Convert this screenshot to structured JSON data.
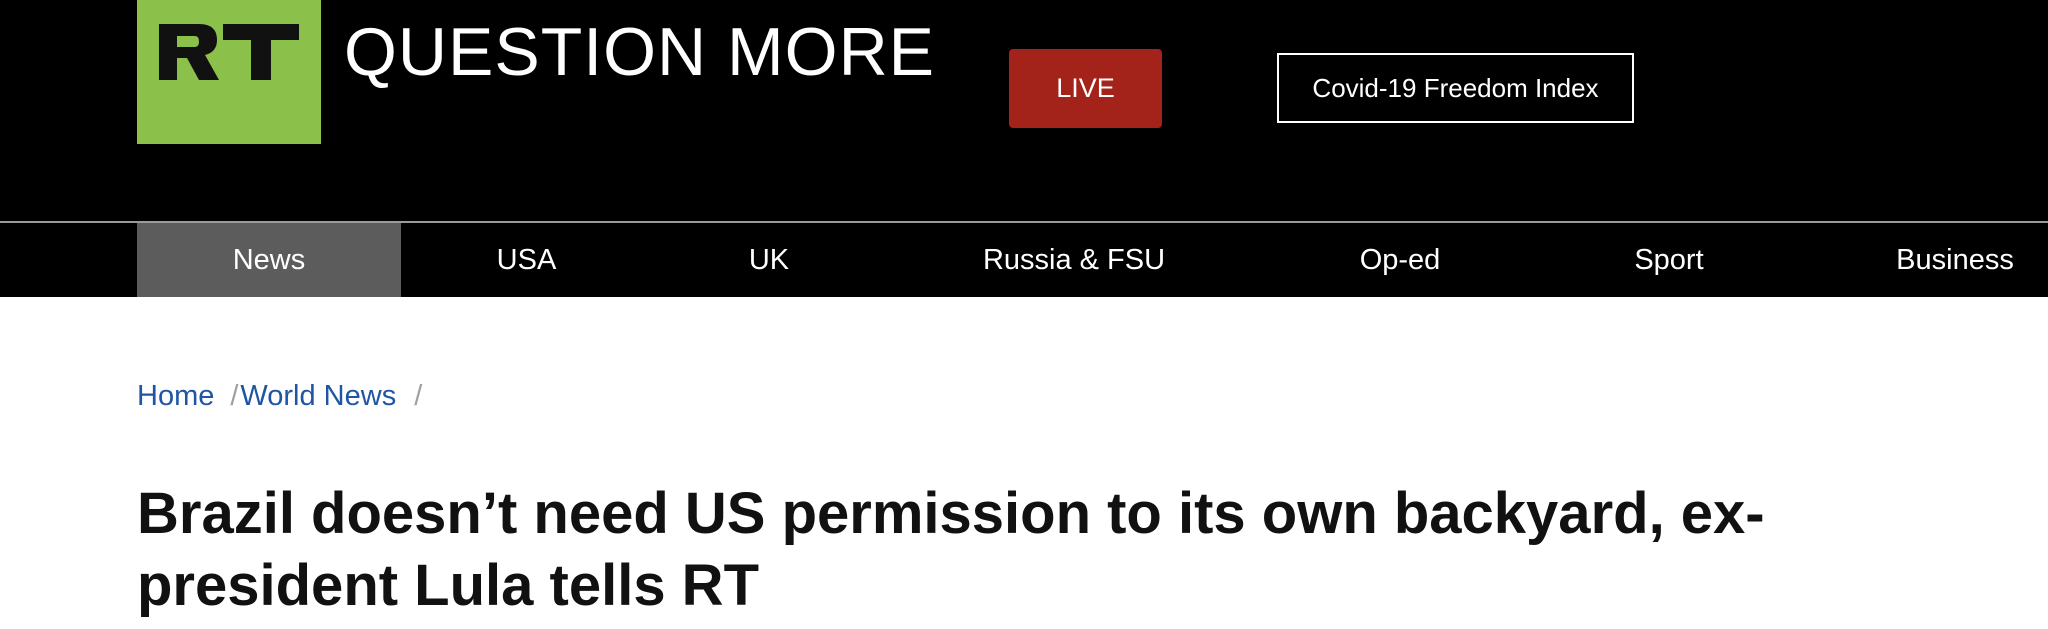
{
  "header": {
    "logo_text": "RT",
    "tagline": "QUESTION MORE",
    "live_label": "LIVE",
    "covid_label": "Covid-19 Freedom Index"
  },
  "nav": {
    "items": [
      {
        "label": "News",
        "active": true
      },
      {
        "label": "USA",
        "active": false
      },
      {
        "label": "UK",
        "active": false
      },
      {
        "label": "Russia & FSU",
        "active": false
      },
      {
        "label": "Op-ed",
        "active": false
      },
      {
        "label": "Sport",
        "active": false
      },
      {
        "label": "Business",
        "active": false
      }
    ]
  },
  "breadcrumb": {
    "items": [
      "Home",
      "World News"
    ],
    "separator": "/"
  },
  "article": {
    "headline": "Brazil doesn’t need US permission to its own backyard, ex-president Lula tells RT"
  },
  "colors": {
    "brand_green": "#8bc04a",
    "live_red": "#a32219",
    "link_blue": "#1f55a3",
    "nav_active": "#5c5c5c"
  }
}
